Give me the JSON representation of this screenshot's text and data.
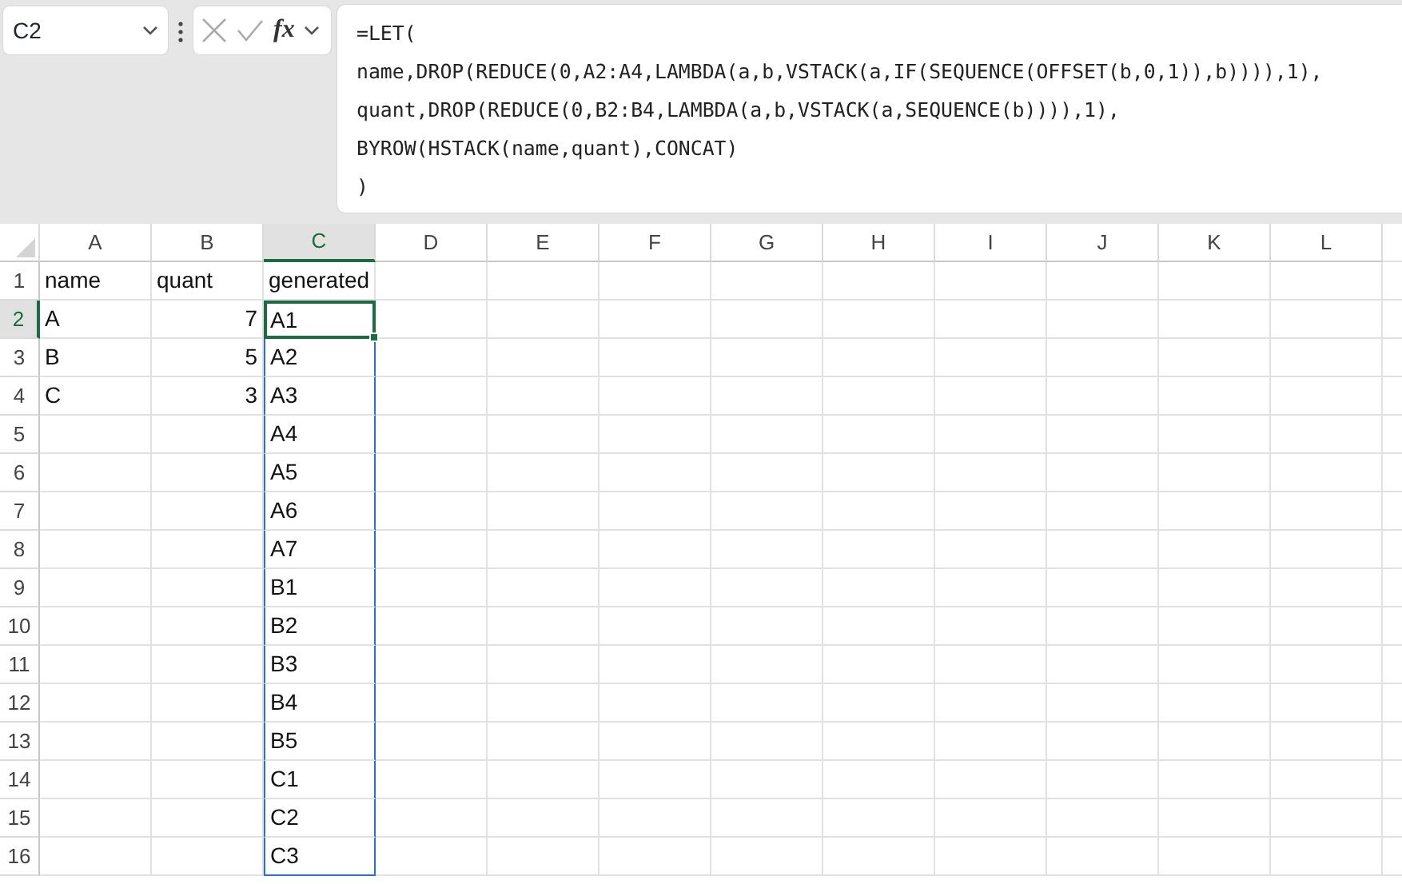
{
  "name_box": {
    "value": "C2"
  },
  "formula_bar": {
    "function_label": "fx",
    "lines": [
      "=LET(",
      "name,DROP(REDUCE(0,A2:A4,LAMBDA(a,b,VSTACK(a,IF(SEQUENCE(OFFSET(b,0,1)),b)))),1),",
      "quant,DROP(REDUCE(0,B2:B4,LAMBDA(a,b,VSTACK(a,SEQUENCE(b)))),1),",
      "BYROW(HSTACK(name,quant),CONCAT)",
      ")"
    ]
  },
  "columns": [
    {
      "label": "A",
      "selected": false
    },
    {
      "label": "B",
      "selected": false
    },
    {
      "label": "C",
      "selected": true
    },
    {
      "label": "D",
      "selected": false
    },
    {
      "label": "E",
      "selected": false
    },
    {
      "label": "F",
      "selected": false
    },
    {
      "label": "G",
      "selected": false
    },
    {
      "label": "H",
      "selected": false
    },
    {
      "label": "I",
      "selected": false
    },
    {
      "label": "J",
      "selected": false
    },
    {
      "label": "K",
      "selected": false
    },
    {
      "label": "L",
      "selected": false
    }
  ],
  "rows": [
    {
      "label": "1",
      "selected": false,
      "cells": [
        {
          "text": "name",
          "kind": "text"
        },
        {
          "text": "quant",
          "kind": "text"
        },
        {
          "text": "generated",
          "kind": "text"
        }
      ]
    },
    {
      "label": "2",
      "selected": true,
      "cells": [
        {
          "text": "A",
          "kind": "text"
        },
        {
          "text": "7",
          "kind": "number"
        },
        {
          "text": "A1",
          "kind": "text",
          "active": true,
          "spill": true
        }
      ]
    },
    {
      "label": "3",
      "selected": false,
      "cells": [
        {
          "text": "B",
          "kind": "text"
        },
        {
          "text": "5",
          "kind": "number"
        },
        {
          "text": "A2",
          "kind": "text",
          "spill": true
        }
      ]
    },
    {
      "label": "4",
      "selected": false,
      "cells": [
        {
          "text": "C",
          "kind": "text"
        },
        {
          "text": "3",
          "kind": "number"
        },
        {
          "text": "A3",
          "kind": "text",
          "spill": true
        }
      ]
    },
    {
      "label": "5",
      "selected": false,
      "cells": [
        null,
        null,
        {
          "text": "A4",
          "kind": "text",
          "spill": true
        }
      ]
    },
    {
      "label": "6",
      "selected": false,
      "cells": [
        null,
        null,
        {
          "text": "A5",
          "kind": "text",
          "spill": true
        }
      ]
    },
    {
      "label": "7",
      "selected": false,
      "cells": [
        null,
        null,
        {
          "text": "A6",
          "kind": "text",
          "spill": true
        }
      ]
    },
    {
      "label": "8",
      "selected": false,
      "cells": [
        null,
        null,
        {
          "text": "A7",
          "kind": "text",
          "spill": true
        }
      ]
    },
    {
      "label": "9",
      "selected": false,
      "cells": [
        null,
        null,
        {
          "text": "B1",
          "kind": "text",
          "spill": true
        }
      ]
    },
    {
      "label": "10",
      "selected": false,
      "cells": [
        null,
        null,
        {
          "text": "B2",
          "kind": "text",
          "spill": true
        }
      ]
    },
    {
      "label": "11",
      "selected": false,
      "cells": [
        null,
        null,
        {
          "text": "B3",
          "kind": "text",
          "spill": true
        }
      ]
    },
    {
      "label": "12",
      "selected": false,
      "cells": [
        null,
        null,
        {
          "text": "B4",
          "kind": "text",
          "spill": true
        }
      ]
    },
    {
      "label": "13",
      "selected": false,
      "cells": [
        null,
        null,
        {
          "text": "B5",
          "kind": "text",
          "spill": true
        }
      ]
    },
    {
      "label": "14",
      "selected": false,
      "cells": [
        null,
        null,
        {
          "text": "C1",
          "kind": "text",
          "spill": true
        }
      ]
    },
    {
      "label": "15",
      "selected": false,
      "cells": [
        null,
        null,
        {
          "text": "C2",
          "kind": "text",
          "spill": true
        }
      ]
    },
    {
      "label": "16",
      "selected": false,
      "cells": [
        null,
        null,
        {
          "text": "C3",
          "kind": "text",
          "spill": true
        }
      ]
    }
  ]
}
